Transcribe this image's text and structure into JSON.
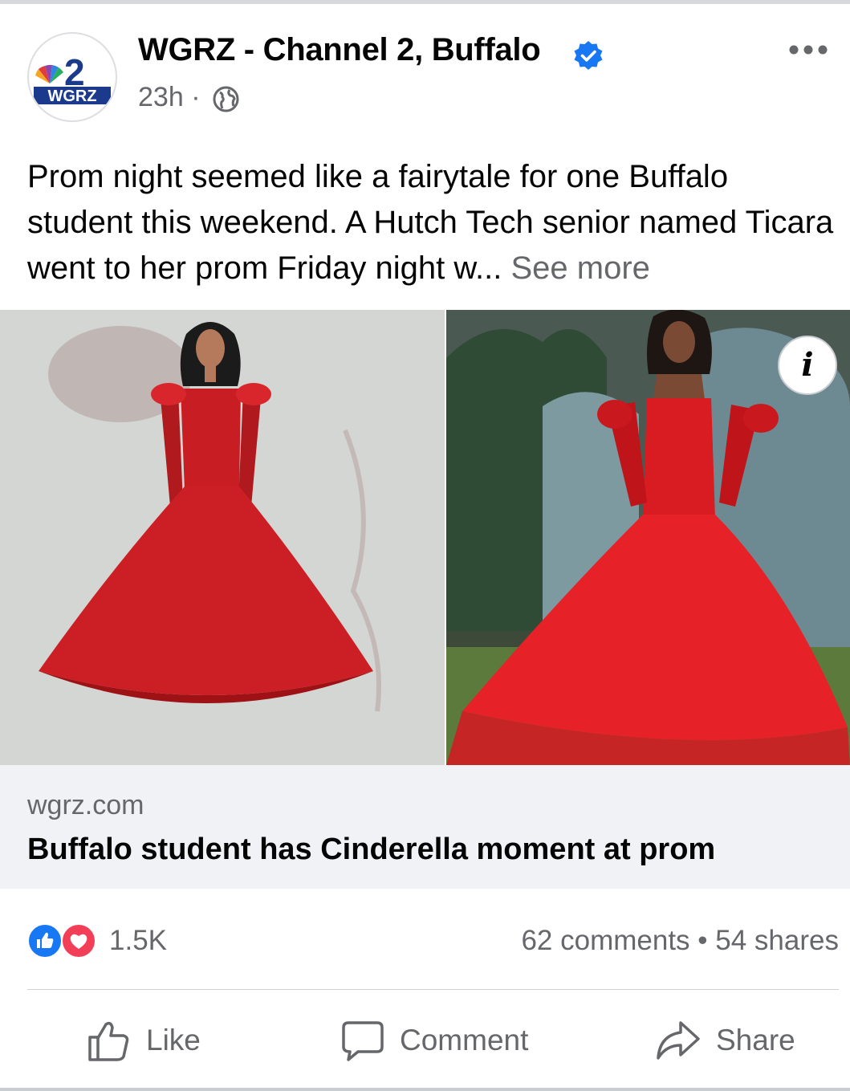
{
  "post": {
    "page_name": "WGRZ - Channel 2, Buffalo",
    "time": "23h",
    "separator": "·",
    "text": "Prom night seemed like a fairytale for one Buffalo student this weekend. A Hutch Tech senior named Ticara went to her prom Friday night w...",
    "see_more": "See more",
    "avatar_logo_text": "WGRZ",
    "avatar_logo_number": "2"
  },
  "media": {
    "left_image": "illustration-red-gown-sketch",
    "right_image": "photo-student-red-gown",
    "info_label": "i"
  },
  "link": {
    "domain": "wgrz.com",
    "title": "Buffalo student has Cinderella moment at prom"
  },
  "engagement": {
    "reactions_count": "1.5K",
    "comments": "62 comments",
    "dot": "•",
    "shares": "54 shares"
  },
  "actions": {
    "like": "Like",
    "comment": "Comment",
    "share": "Share"
  },
  "colors": {
    "verified_blue": "#1877f2",
    "like_blue": "#1877f2",
    "love_red": "#f33e58",
    "secondary_text": "#65676b",
    "link_bg": "#f0f2f5"
  }
}
